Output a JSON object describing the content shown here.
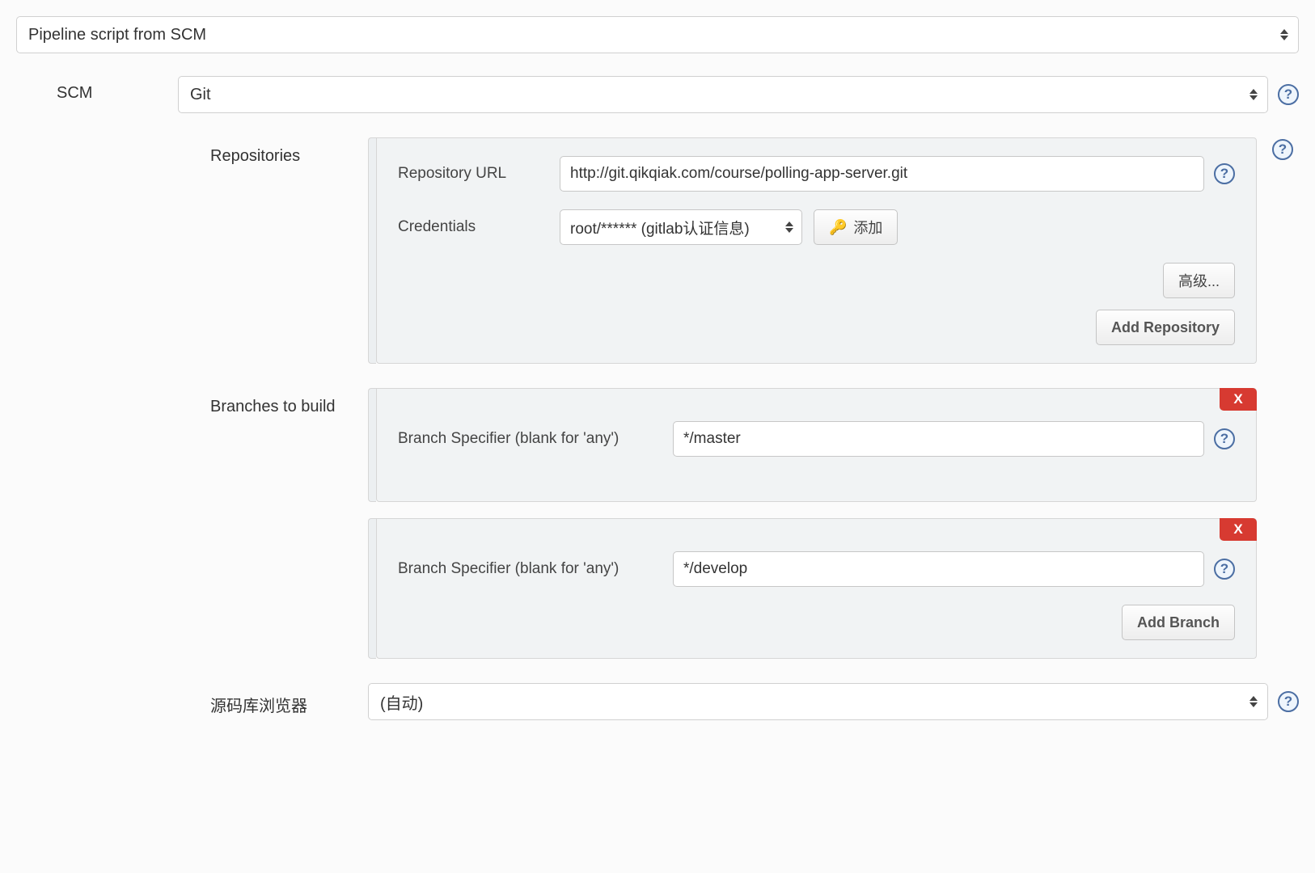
{
  "definition": {
    "selected": "Pipeline script from SCM"
  },
  "scm": {
    "label": "SCM",
    "selected": "Git",
    "repositories": {
      "label": "Repositories",
      "repoUrlLabel": "Repository URL",
      "repoUrl": "http://git.qikqiak.com/course/polling-app-server.git",
      "credentialsLabel": "Credentials",
      "credentialsSelected": "root/****** (gitlab认证信息)",
      "addCredBtn": "添加",
      "advancedBtn": "高级...",
      "addRepoBtn": "Add Repository"
    },
    "branches": {
      "label": "Branches to build",
      "specifierLabel": "Branch Specifier (blank for 'any')",
      "items": [
        {
          "value": "*/master"
        },
        {
          "value": "*/develop"
        }
      ],
      "deleteLabel": "X",
      "addBranchBtn": "Add Branch"
    },
    "browser": {
      "label": "源码库浏览器",
      "selected": "(自动)"
    }
  }
}
